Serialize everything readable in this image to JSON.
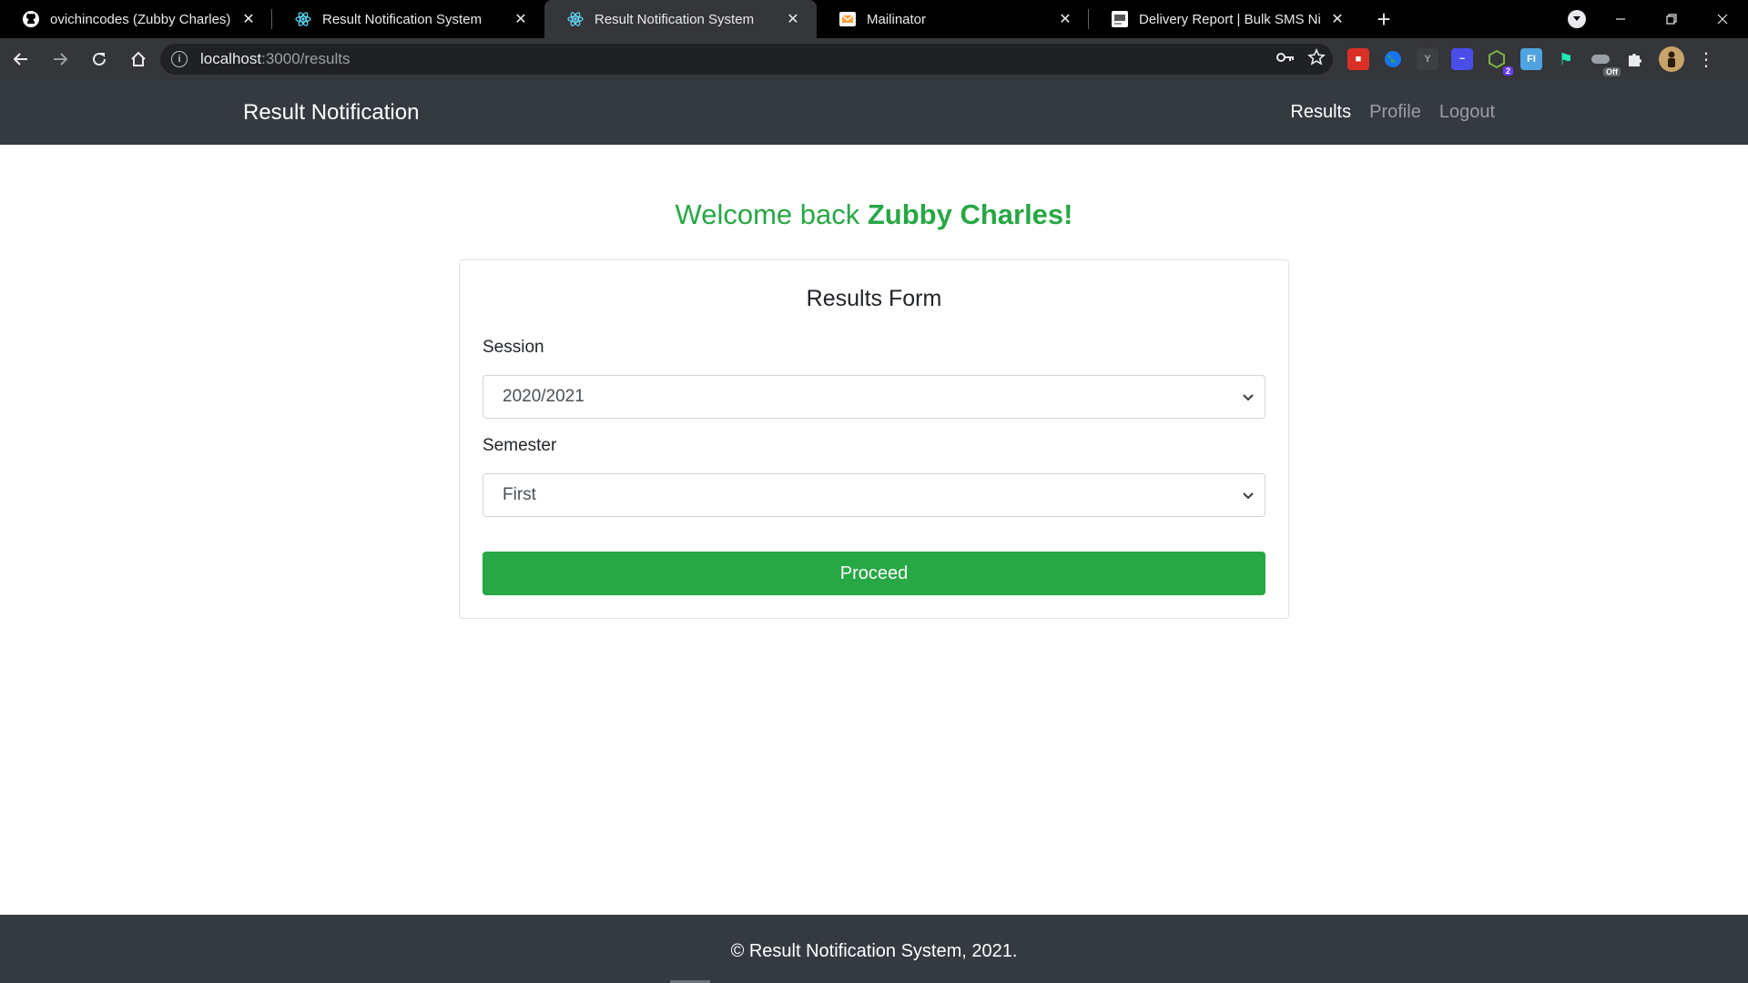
{
  "browser": {
    "tabs": [
      {
        "title": "ovichincodes (Zubby Charles)",
        "favicon": "github-icon",
        "active": false
      },
      {
        "title": "Result Notification System",
        "favicon": "react-icon",
        "active": false
      },
      {
        "title": "Result Notification System",
        "favicon": "react-icon",
        "active": true
      },
      {
        "title": "Mailinator",
        "favicon": "mailinator-icon",
        "active": false
      },
      {
        "title": "Delivery Report | Bulk SMS Niger",
        "favicon": "sms-icon",
        "active": false
      }
    ],
    "url_host": "localhost",
    "url_path": ":3000/results",
    "extension_badges": {
      "count": "2",
      "off": "Off"
    },
    "accent": "#35363a"
  },
  "navbar": {
    "brand": "Result Notification",
    "links": [
      {
        "label": "Results",
        "active": true
      },
      {
        "label": "Profile",
        "active": false
      },
      {
        "label": "Logout",
        "active": false
      }
    ],
    "background": "#343a40"
  },
  "welcome": {
    "prefix": "Welcome back ",
    "name": "Zubby Charles!",
    "color": "#28a745"
  },
  "form": {
    "title": "Results Form",
    "session": {
      "label": "Session",
      "value": "2020/2021"
    },
    "semester": {
      "label": "Semester",
      "value": "First"
    },
    "submit_label": "Proceed",
    "submit_color": "#28a745"
  },
  "footer": {
    "text": "© Result Notification System, 2021."
  }
}
